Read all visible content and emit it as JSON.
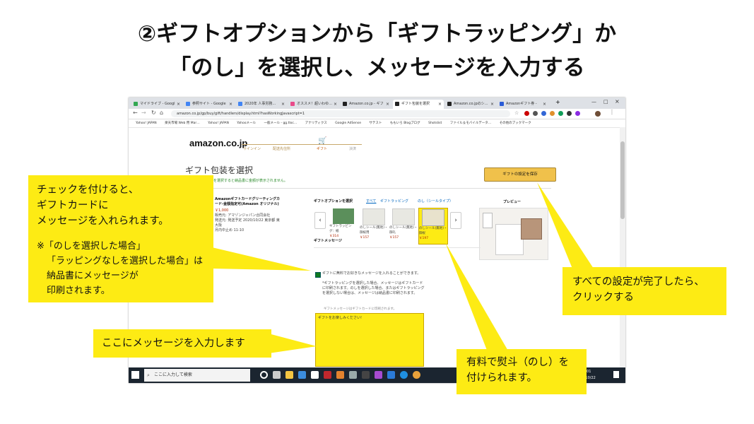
{
  "slide": {
    "title_line1": "②ギフトオプションから「ギフトラッピング」か",
    "title_line2": "「のし」を選択し、メッセージを入力する"
  },
  "browser": {
    "tabs": [
      "マイドライブ - Googl",
      "参照サイト - Google",
      "2020年 人事労務…",
      "オススメ！超いわゆ…",
      "Amazon.co.jp - ギフ",
      "ギフト包装を選択",
      "Amazon.co.jpのシ…",
      "Amazonギフト券 -"
    ],
    "url": "amazon.co.jp/gp/buy/gift/handlers/display.html?hasWorkingJavascript=1",
    "bookmarks": [
      "Yahoo! JAPAN",
      "楽天市場 Web 用 Mar…",
      "Yahoo! JAPAN",
      "Yahooメール",
      "一般メール - gg.tloc…",
      "アナリティクス",
      "Google AdSense",
      "サテスト",
      "ももいろ Blogブログ",
      "Shotslist",
      "ファイル＆モバイルデータ…",
      "その他のブックマーク"
    ]
  },
  "amazon": {
    "logo": "amazon.co.jp",
    "steps": [
      "サインイン",
      "配送先住所",
      "ギフト",
      "決済"
    ],
    "page_title": "ギフト包装を選択",
    "page_note": "ギフトラッピングを選択すると納品書に金額が表示されません。",
    "save_button": "ギフトの設定を保存",
    "product_name": "Amazonギフトカードグリーティングカード-金額指定可(Amazon オリジナル)",
    "product_price": "￥1,000",
    "product_seller": "販売元: アマゾンジャパン合同会社",
    "product_ship": "発送元: 発送予定 2020/10/22 東京都 東大阪",
    "product_arrival": "月内中止め 11-10",
    "options_label": "ギフトオプションを選択",
    "filters": [
      "すべて",
      "ギフトラッピング",
      "のし（シールタイプ）"
    ],
    "options": [
      {
        "label": "ギフトラッピング：紙",
        "price": "￥314"
      },
      {
        "label": "のしシール(無地)・御祝用",
        "price": "￥157"
      },
      {
        "label": "のしシール(無地)・御礼",
        "price": "￥157"
      },
      {
        "label": "のしシール(無地)・御祝",
        "price": "￥197"
      }
    ],
    "preview_label": "プレビュー",
    "message_label": "ギフトメッセージ",
    "message_checkbox": "ギフトに無料でお好きなメッセージを入れることができます。",
    "message_note1": "*ギフトラッピングを選択した場合、メッセージはギフトカードに印刷されます。のしを選択した場合、またはギフトラッピングを選択しない場合は、メッセージは納品書に印刷されます。",
    "message_note2": "ギフトメッセージはギフトカードに印刷されます。",
    "message_text": "ギフトをお楽しみください!"
  },
  "taskbar": {
    "search_placeholder": "ここに入力して検索",
    "time": "11:01",
    "date": "2020/10/22"
  },
  "callouts": {
    "checkbox_lines": [
      "チェックを付けると、",
      "ギフトカードに",
      "メッセージを入れられます。"
    ],
    "noshi_lines": [
      "※「のしを選択した場合」",
      "「ラッピングなしを選択した場合」は",
      "納品書にメッセージが",
      "印刷されます。"
    ],
    "message_input": "ここにメッセージを入力します",
    "save_lines": [
      "すべての設定が完了したら、",
      "クリックする"
    ],
    "noshi_paid_lines": [
      "有料で熨斗（のし）を",
      "付けられます。"
    ]
  },
  "colors": {
    "callout_yellow": "#fdeb14",
    "amazon_button": "#f0c14b",
    "taskbar": "#1b2530"
  }
}
